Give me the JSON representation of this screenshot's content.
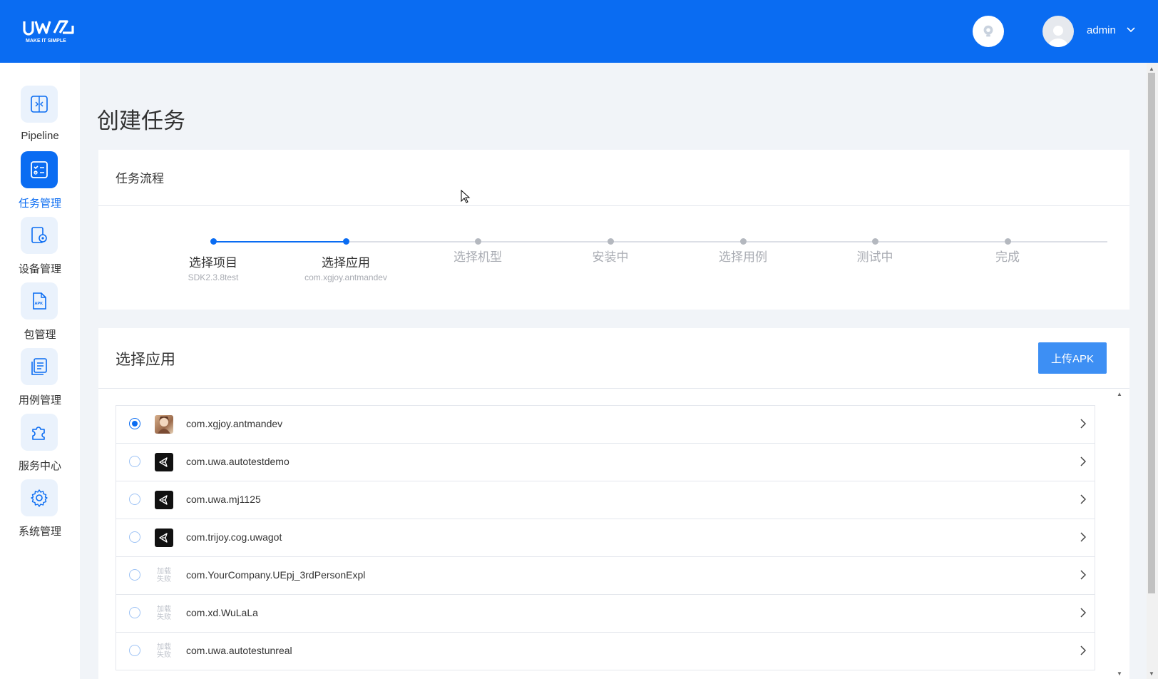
{
  "header": {
    "logo_text": "UWA",
    "logo_tagline": "MAKE IT SIMPLE",
    "username": "admin",
    "colors": {
      "brand": "#0a6cf2"
    }
  },
  "sidebar": {
    "items": [
      {
        "label": "Pipeline",
        "icon": "pipeline-icon",
        "active": false
      },
      {
        "label": "任务管理",
        "icon": "task-list-icon",
        "active": true
      },
      {
        "label": "设备管理",
        "icon": "device-icon",
        "active": false
      },
      {
        "label": "包管理",
        "icon": "apk-icon",
        "active": false
      },
      {
        "label": "用例管理",
        "icon": "testcase-icon",
        "active": false
      },
      {
        "label": "服务中心",
        "icon": "puzzle-icon",
        "active": false
      },
      {
        "label": "系统管理",
        "icon": "gear-icon",
        "active": false
      }
    ]
  },
  "page": {
    "title": "创建任务"
  },
  "flow": {
    "title": "任务流程",
    "steps": [
      {
        "title": "选择项目",
        "sub": "SDK2.3.8test",
        "done": true
      },
      {
        "title": "选择应用",
        "sub": "com.xgjoy.antmandev",
        "done": true
      },
      {
        "title": "选择机型",
        "sub": "",
        "done": false
      },
      {
        "title": "安装中",
        "sub": "",
        "done": false
      },
      {
        "title": "选择用例",
        "sub": "",
        "done": false
      },
      {
        "title": "测试中",
        "sub": "",
        "done": false
      },
      {
        "title": "完成",
        "sub": "",
        "done": false
      }
    ]
  },
  "apps": {
    "title": "选择应用",
    "upload_label": "上传APK",
    "fail_icon_text_1": "加载",
    "fail_icon_text_2": "失败",
    "rows": [
      {
        "package": "com.xgjoy.antmandev",
        "icon": "photo",
        "selected": true
      },
      {
        "package": "com.uwa.autotestdemo",
        "icon": "unity",
        "selected": false
      },
      {
        "package": "com.uwa.mj1125",
        "icon": "unity",
        "selected": false
      },
      {
        "package": "com.trijoy.cog.uwagot",
        "icon": "unity",
        "selected": false
      },
      {
        "package": "com.YourCompany.UEpj_3rdPersonExpl",
        "icon": "fail",
        "selected": false
      },
      {
        "package": "com.xd.WuLaLa",
        "icon": "fail",
        "selected": false
      },
      {
        "package": "com.uwa.autotestunreal",
        "icon": "fail",
        "selected": false
      }
    ]
  }
}
